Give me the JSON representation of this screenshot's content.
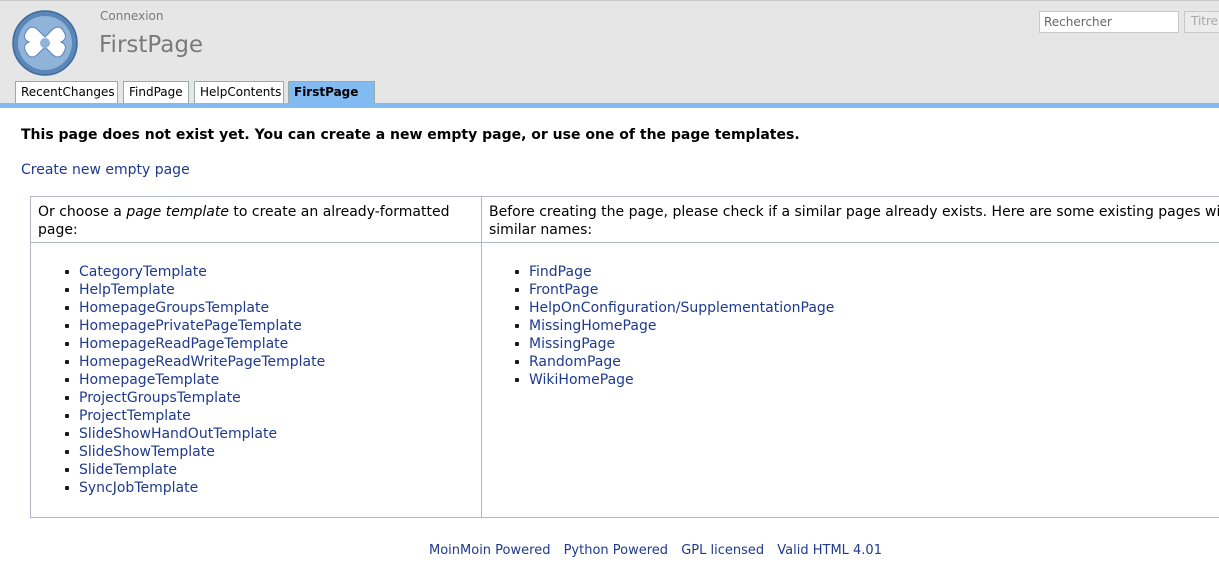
{
  "header": {
    "login_label": "Connexion",
    "page_title": "FirstPage",
    "search_placeholder": "Rechercher",
    "titles_button": "Titre"
  },
  "tabs": [
    {
      "label": "RecentChanges",
      "active": false
    },
    {
      "label": "FindPage",
      "active": false
    },
    {
      "label": "HelpContents",
      "active": false
    },
    {
      "label": "FirstPage",
      "active": true
    }
  ],
  "colors": {
    "accent": "#81bbf2",
    "header_bg": "#e6e6e6",
    "link": "#1e3a8c"
  },
  "content": {
    "notice": "This page does not exist yet. You can create a new empty page, or use one of the page templates.",
    "create_link": "Create new empty page",
    "left_header_before": "Or choose a ",
    "left_header_em": "page template",
    "left_header_after": " to create an already-formatted page:",
    "right_header": "Before creating the page, please check if a similar page already exists. Here are some existing pages with similar names:",
    "templates": [
      "CategoryTemplate",
      "HelpTemplate",
      "HomepageGroupsTemplate",
      "HomepagePrivatePageTemplate",
      "HomepageReadPageTemplate",
      "HomepageReadWritePageTemplate",
      "HomepageTemplate",
      "ProjectGroupsTemplate",
      "ProjectTemplate",
      "SlideShowHandOutTemplate",
      "SlideShowTemplate",
      "SlideTemplate",
      "SyncJobTemplate"
    ],
    "similar_pages": [
      "FindPage",
      "FrontPage",
      "HelpOnConfiguration/SupplementationPage",
      "MissingHomePage",
      "MissingPage",
      "RandomPage",
      "WikiHomePage"
    ]
  },
  "footer": {
    "links": [
      "MoinMoin Powered",
      "Python Powered",
      "GPL licensed",
      "Valid HTML 4.01"
    ]
  }
}
